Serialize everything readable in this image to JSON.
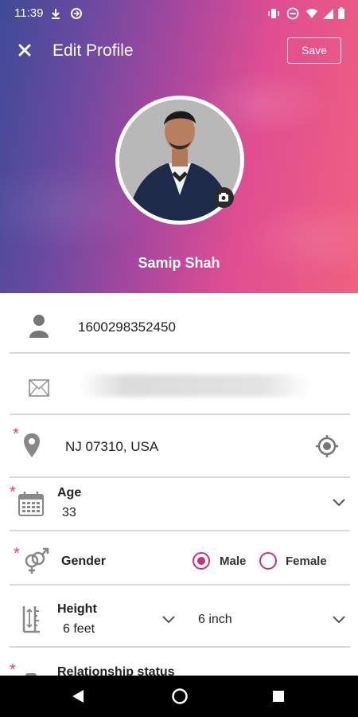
{
  "status_bar": {
    "time": "11:39",
    "icons": [
      "download-icon",
      "sync-icon",
      "vibrate-icon",
      "dnd-icon",
      "wifi-icon",
      "signal-icon",
      "battery-icon"
    ]
  },
  "app_bar": {
    "title": "Edit Profile",
    "save_label": "Save",
    "close_icon": "close-icon"
  },
  "profile": {
    "name": "Samip Shah"
  },
  "fields": {
    "phone": {
      "value": "1600298352450",
      "icon": "person-icon"
    },
    "email": {
      "value": "",
      "icon": "mail-icon"
    },
    "location": {
      "value": "NJ 07310, USA",
      "icon": "location-pin-icon",
      "action_icon": "gps-target-icon"
    },
    "age": {
      "label": "Age",
      "value": "33",
      "icon": "calendar-icon"
    },
    "gender": {
      "label": "Gender",
      "options": [
        "Male",
        "Female"
      ],
      "selected": "Male",
      "icon": "gender-icon"
    },
    "height": {
      "label": "Height",
      "feet_value": "6 feet",
      "inch_value": "6 inch",
      "icon": "height-icon"
    },
    "relationship": {
      "label": "Relationship status"
    }
  },
  "required_marker": "*",
  "colors": {
    "accent": "#c9317a",
    "required": "#e0407a",
    "header_gradient": [
      "#3f4a98",
      "#a8479e",
      "#f0607f"
    ]
  }
}
